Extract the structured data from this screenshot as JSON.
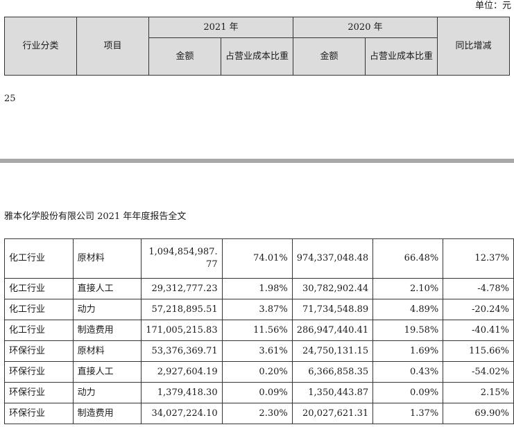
{
  "unit_label": "单位：元",
  "header": {
    "industry": "行业分类",
    "item": "项目",
    "year_2021": "2021 年",
    "year_2020": "2020 年",
    "amount_2021": "金额",
    "ratio_2021": "占营业成本比重",
    "amount_2020": "金额",
    "ratio_2020": "占营业成本比重",
    "yoy": "同比增减"
  },
  "page_number": "25",
  "doc_header": "雅本化学股份有限公司 2021 年年度报告全文",
  "rows": [
    {
      "industry": "化工行业",
      "item": "原材料",
      "amount_2021": "1,094,854,987.77",
      "ratio_2021": "74.01%",
      "amount_2020": "974,337,048.48",
      "ratio_2020": "66.48%",
      "yoy": "12.37%"
    },
    {
      "industry": "化工行业",
      "item": "直接人工",
      "amount_2021": "29,312,777.23",
      "ratio_2021": "1.98%",
      "amount_2020": "30,782,902.44",
      "ratio_2020": "2.10%",
      "yoy": "-4.78%"
    },
    {
      "industry": "化工行业",
      "item": "动力",
      "amount_2021": "57,218,895.51",
      "ratio_2021": "3.87%",
      "amount_2020": "71,734,548.89",
      "ratio_2020": "4.89%",
      "yoy": "-20.24%"
    },
    {
      "industry": "化工行业",
      "item": "制造费用",
      "amount_2021": "171,005,215.83",
      "ratio_2021": "11.56%",
      "amount_2020": "286,947,440.41",
      "ratio_2020": "19.58%",
      "yoy": "-40.41%"
    },
    {
      "industry": "环保行业",
      "item": "原材料",
      "amount_2021": "53,376,369.71",
      "ratio_2021": "3.61%",
      "amount_2020": "24,750,131.15",
      "ratio_2020": "1.69%",
      "yoy": "115.66%"
    },
    {
      "industry": "环保行业",
      "item": "直接人工",
      "amount_2021": "2,927,604.19",
      "ratio_2021": "0.20%",
      "amount_2020": "6,366,858.35",
      "ratio_2020": "0.43%",
      "yoy": "-54.02%"
    },
    {
      "industry": "环保行业",
      "item": "动力",
      "amount_2021": "1,379,418.30",
      "ratio_2021": "0.09%",
      "amount_2020": "1,350,443.87",
      "ratio_2020": "0.09%",
      "yoy": "2.15%"
    },
    {
      "industry": "环保行业",
      "item": "制造费用",
      "amount_2021": "34,027,224.10",
      "ratio_2021": "2.30%",
      "amount_2020": "20,027,621.31",
      "ratio_2020": "1.37%",
      "yoy": "69.90%"
    }
  ]
}
